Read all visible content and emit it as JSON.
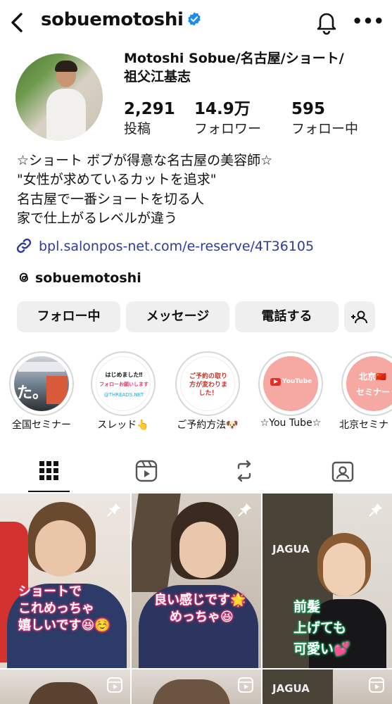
{
  "header": {
    "username": "sobuemotoshi"
  },
  "profile": {
    "full_name_line1": "Motoshi Sobue/名古屋/ショート/",
    "full_name_line2": "祖父江基志"
  },
  "stats": [
    {
      "value": "2,291",
      "label": "投稿"
    },
    {
      "value": "14.9万",
      "label": "フォロワー"
    },
    {
      "value": "595",
      "label": "フォロー中"
    }
  ],
  "bio": [
    "☆ショート ボブが得意な名古屋の美容師☆",
    "\"女性が求めているカットを追求\"",
    "名古屋で一番ショートを切る人",
    "家で仕上がるレベルが違う"
  ],
  "link": "bpl.salonpos-net.com/e-reserve/4T36105",
  "threads_handle": "sobuemotoshi",
  "buttons": {
    "following": "フォロー中",
    "message": "メッセージ",
    "call": "電話する"
  },
  "highlights": [
    {
      "label": "全国セミナー",
      "cover_text": "た。"
    },
    {
      "label": "スレッド👆",
      "cover_text_1": "はじめました‼",
      "cover_text_2": "フォローお願いします",
      "cover_text_3": "@THREADS.NET"
    },
    {
      "label": "ご予約方法🐶",
      "cover_text": "ご予約の取り方が変わりました！"
    },
    {
      "label": "☆You Tube☆",
      "cover_text": "YouTube"
    },
    {
      "label": "北京セミナ",
      "cover_text_1": "北京🇨🇳",
      "cover_text_2": "セミナー"
    }
  ],
  "posts": [
    {
      "caption": [
        "ショートで",
        "これめっちゃ",
        "嬉しいです😆☺️"
      ],
      "type": "pinned"
    },
    {
      "caption": [
        "良い感じです🌟",
        "めっちゃ😆"
      ],
      "type": "pinned"
    },
    {
      "caption": [
        "前髪",
        "上げても",
        "可愛い💕"
      ],
      "type": "pinned",
      "shirt_text": "JAGUA"
    }
  ],
  "colors": {
    "link": "#2e3b9a",
    "verified": "#1a8cf0",
    "button_bg": "#efefef",
    "youtube_cover": "#f6a8a2"
  }
}
